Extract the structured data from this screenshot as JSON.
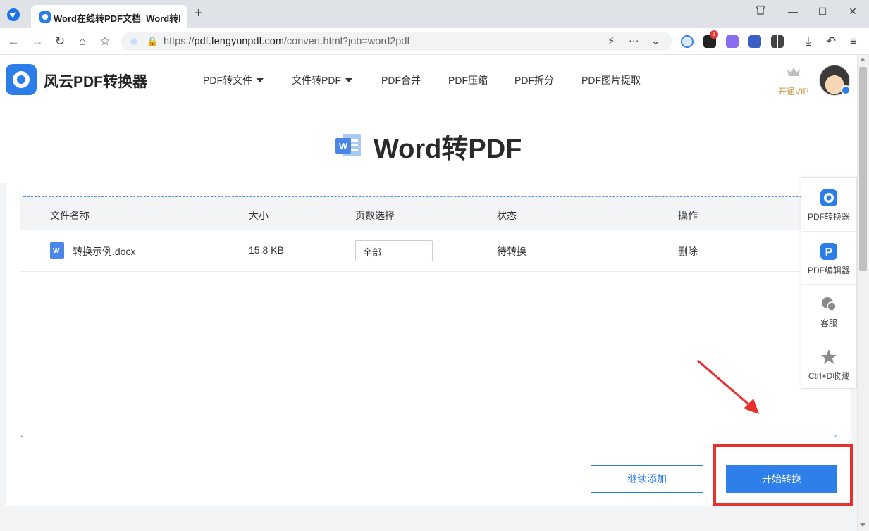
{
  "browser": {
    "tab_title": "Word在线转PDF文档_Word转PDF",
    "url_prefix": "https://",
    "url_domain": "pdf.fengyunpdf.com",
    "url_path": "/convert.html?job=word2pdf",
    "extension_badge": "1",
    "window_controls": [
      "skin-icon",
      "minimize-icon",
      "maximize-icon",
      "close-icon"
    ]
  },
  "header": {
    "logo_text": "风云PDF转换器",
    "nav": [
      {
        "label": "PDF转文件",
        "has_dropdown": true
      },
      {
        "label": "文件转PDF",
        "has_dropdown": true
      },
      {
        "label": "PDF合并"
      },
      {
        "label": "PDF压缩"
      },
      {
        "label": "PDF拆分"
      },
      {
        "label": "PDF图片提取"
      }
    ],
    "vip_label": "开通VIP"
  },
  "main": {
    "title": "Word转PDF",
    "table": {
      "columns": [
        "文件名称",
        "大小",
        "页数选择",
        "状态",
        "操作"
      ],
      "rows": [
        {
          "name": "转换示例.docx",
          "size": "15.8 KB",
          "pages": "全部",
          "status": "待转换",
          "action": "删除"
        }
      ]
    },
    "continue_label": "继续添加",
    "start_label": "开始转换"
  },
  "side_panel": [
    {
      "label": "PDF转换器",
      "icon": "converter-icon",
      "color": "#2b7de9"
    },
    {
      "label": "PDF编辑器",
      "icon": "editor-icon",
      "color": "#2b7de9"
    },
    {
      "label": "客服",
      "icon": "chat-icon",
      "color": "#8a8a8a"
    },
    {
      "label": "Ctrl+D收藏",
      "icon": "star-icon",
      "color": "#8a8a8a"
    }
  ],
  "colors": {
    "accent": "#2f7fea",
    "highlight": "#e8302f",
    "vip": "#c79a4a"
  }
}
